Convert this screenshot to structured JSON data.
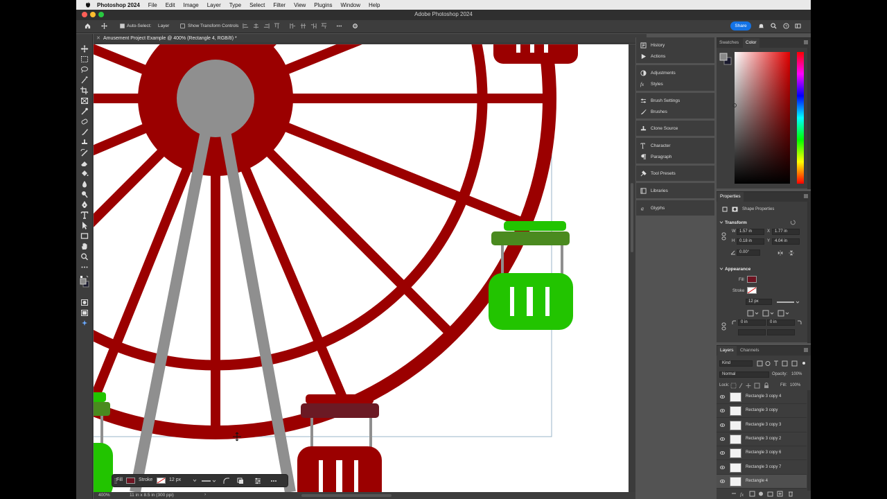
{
  "menubar": {
    "app_name": "Photoshop 2024",
    "items": [
      "File",
      "Edit",
      "Image",
      "Layer",
      "Type",
      "Select",
      "Filter",
      "View",
      "Plugins",
      "Window",
      "Help"
    ]
  },
  "window": {
    "title": "Adobe Photoshop 2024"
  },
  "options_bar": {
    "auto_select_label": "Auto-Select:",
    "auto_select_value": "Layer",
    "show_transform_label": "Show Transform Controls",
    "share_label": "Share"
  },
  "document": {
    "tab_title": "Amusement Project Example @ 400% (Rectangle 4, RGB/8) *",
    "zoom": "400%",
    "doc_info": "11 in x 8.5 in (300 ppi)"
  },
  "context_bar": {
    "fill_label": "Fill",
    "stroke_label": "Stroke",
    "stroke_width": "12 px"
  },
  "panel_column": {
    "groups": [
      [
        {
          "label": "History",
          "icon": "history-icon"
        },
        {
          "label": "Actions",
          "icon": "actions-icon"
        }
      ],
      [
        {
          "label": "Adjustments",
          "icon": "adjustments-icon"
        },
        {
          "label": "Styles",
          "icon": "styles-icon"
        }
      ],
      [
        {
          "label": "Brush Settings",
          "icon": "brush-settings-icon"
        },
        {
          "label": "Brushes",
          "icon": "brushes-icon"
        }
      ],
      [
        {
          "label": "Clone Source",
          "icon": "clone-source-icon"
        }
      ],
      [
        {
          "label": "Character",
          "icon": "character-icon"
        },
        {
          "label": "Paragraph",
          "icon": "paragraph-icon"
        }
      ],
      [
        {
          "label": "Tool Presets",
          "icon": "tool-presets-icon"
        }
      ],
      [
        {
          "label": "Libraries",
          "icon": "libraries-icon"
        }
      ],
      [
        {
          "label": "Glyphs",
          "icon": "glyphs-icon"
        }
      ]
    ]
  },
  "color_panel": {
    "tabs": [
      "Swatches",
      "Color"
    ],
    "active_tab": "Color"
  },
  "properties": {
    "title": "Properties",
    "shape_label": "Shape Properties",
    "transform_label": "Transform",
    "w_label": "W",
    "w_value": "1.57 in",
    "x_label": "X",
    "x_value": "1.77 in",
    "h_label": "H",
    "h_value": "0.18 in",
    "y_label": "Y",
    "y_value": "4.04 in",
    "angle_value": "0.00°",
    "appearance_label": "Appearance",
    "fill_label": "Fill",
    "stroke_label": "Stroke",
    "stroke_width": "12 px",
    "corner_tl": "0 in",
    "corner_tr": "0 in"
  },
  "layers_panel": {
    "tabs": [
      "Layers",
      "Channels"
    ],
    "filter_kind": "Kind",
    "blend_mode": "Normal",
    "opacity_label": "Opacity:",
    "opacity_value": "100%",
    "lock_label": "Lock:",
    "fill_label": "Fill:",
    "fill_value": "100%",
    "layers": [
      "Rectangle 3 copy 4",
      "Rectangle 3 copy",
      "Rectangle 3 copy 3",
      "Rectangle 3 copy 2",
      "Rectangle 3 copy 6",
      "Rectangle 3 copy 7",
      "Rectangle 4"
    ],
    "selected_layer": "Rectangle 4"
  },
  "colors": {
    "wheel_red": "#9b0000",
    "hub_gray": "#8f8f8f",
    "cabin_green": "#22c400",
    "cabin_dark_green": "#4a8a1f",
    "selected_cabin_top": "#6b1a24",
    "fill_swatch": "#6e1422",
    "accent_blue": "#1473e6"
  }
}
